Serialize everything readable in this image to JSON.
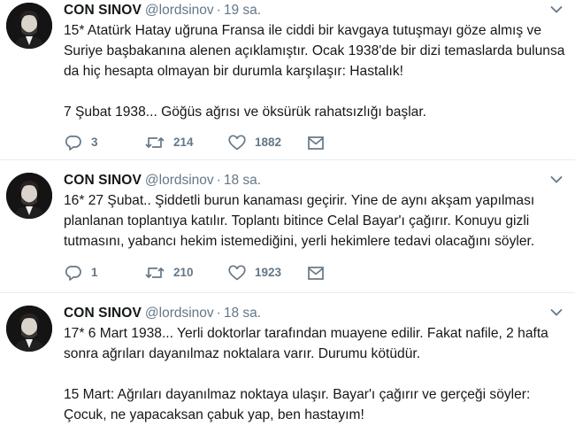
{
  "colors": {
    "name": "#14171a",
    "secondary": "#657786",
    "divider": "#e6ecf0",
    "background": "#ffffff"
  },
  "icons": {
    "reply": "reply-icon",
    "retweet": "retweet-icon",
    "like": "heart-icon",
    "dm": "envelope-icon",
    "menu": "chevron-down-icon"
  },
  "tweets": [
    {
      "display_name": "CON SINOV",
      "handle": "@lordsinov",
      "separator": "·",
      "time": "19 sa.",
      "paragraphs": [
        "15* Atatürk Hatay uğruna Fransa ile ciddi bir kavgaya tutuşmayı göze almış ve\nSuriye başbakanına alenen açıklamıştır. Ocak 1938'de bir dizi temaslarda bulunsa\nda hiç hesapta olmayan bir durumla karşılaşır: Hastalık!",
        "7 Şubat 1938... Göğüs ağrısı ve öksürük rahatsızlığı başlar."
      ],
      "replies": "3",
      "retweets": "214",
      "likes": "1882"
    },
    {
      "display_name": "CON SINOV",
      "handle": "@lordsinov",
      "separator": "·",
      "time": "18 sa.",
      "paragraphs": [
        "16* 27 Şubat.. Şiddetli burun kanaması geçirir. Yine de aynı akşam yapılması\nplanlanan toplantıya katılır. Toplantı bitince Celal Bayar'ı çağırır. Konuyu gizli\ntutmasını, yabancı hekim istemediğini, yerli hekimlere tedavi olacağını söyler."
      ],
      "replies": "1",
      "retweets": "210",
      "likes": "1923"
    },
    {
      "display_name": "CON SINOV",
      "handle": "@lordsinov",
      "separator": "·",
      "time": "18 sa.",
      "paragraphs": [
        "17* 6 Mart 1938... Yerli doktorlar tarafından muayene edilir. Fakat nafile, 2 hafta\nsonra ağrıları dayanılmaz noktalara varır. Durumu kötüdür.",
        "15 Mart: Ağrıları dayanılmaz noktaya ulaşır. Bayar'ı çağırır ve gerçeği söyler:\nÇocuk, ne yapacaksan çabuk yap, ben hastayım!"
      ]
    }
  ]
}
